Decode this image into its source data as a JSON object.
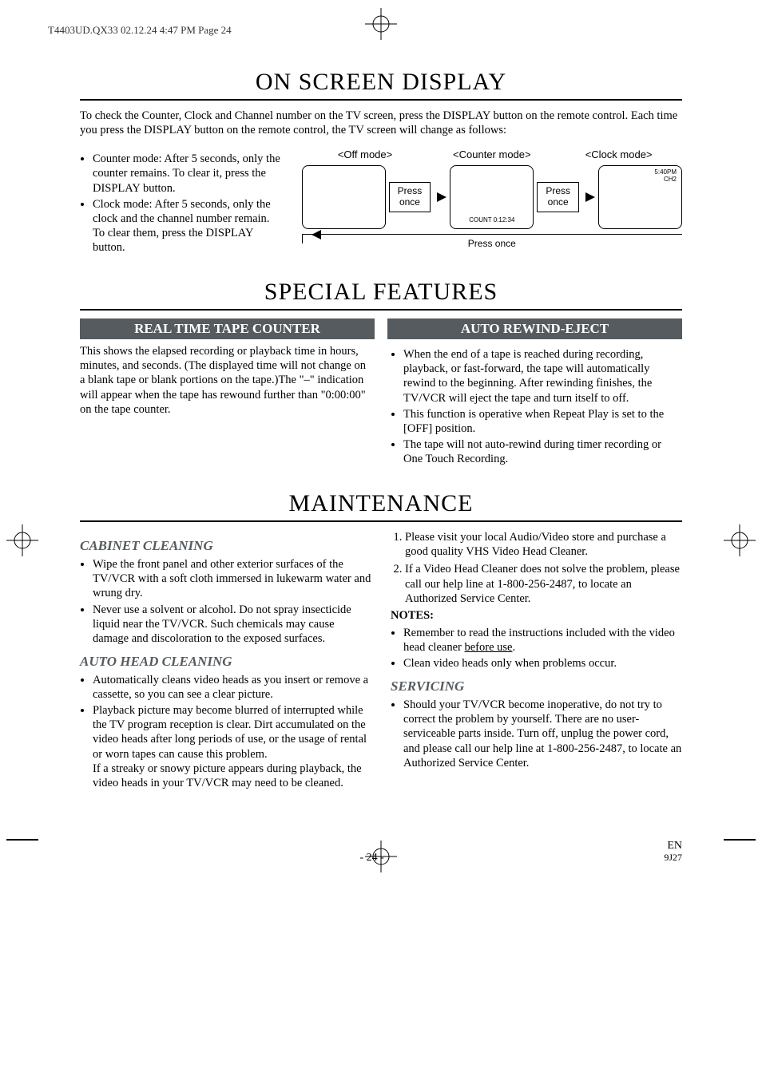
{
  "printHeader": "T4403UD.QX33  02.12.24  4:47 PM  Page 24",
  "sections": {
    "osd": {
      "title": "ON SCREEN DISPLAY",
      "intro": "To check the Counter, Clock and Channel number on the TV screen, press the DISPLAY button on the remote control. Each time you press the DISPLAY button on the remote control, the TV screen will change as follows:",
      "bullets": [
        "Counter mode: After 5 seconds, only the counter remains. To clear it, press the DISPLAY button.",
        "Clock mode: After 5 seconds, only the clock and the channel number remain. To clear them, press the DISPLAY button."
      ],
      "diagram": {
        "offLabel": "<Off mode>",
        "counterLabel": "<Counter mode>",
        "clockLabel": "<Clock mode>",
        "pressOnce": "Press once",
        "press": "Press",
        "once": "once",
        "countReadout": "COUNT  0:12:34",
        "clockReadout1": "5:40PM",
        "clockReadout2": "CH2"
      }
    },
    "special": {
      "title": "SPECIAL FEATURES",
      "rtc": {
        "heading": "REAL TIME TAPE COUNTER",
        "body": "This shows the elapsed recording or playback time in hours, minutes, and seconds. (The displayed time will not change on a blank tape or blank portions on the tape.)The \"–\" indication will appear when the tape has rewound further than \"0:00:00\" on the tape counter."
      },
      "are": {
        "heading": "AUTO REWIND-EJECT",
        "bullets": [
          "When the end of a tape is reached during recording, playback, or fast-forward, the tape will automatically rewind to the beginning. After rewinding finishes, the TV/VCR will eject the tape and turn itself to off.",
          "This function is operative when Repeat Play is set to the [OFF] position.",
          "The tape will not auto-rewind during timer recording or One Touch Recording."
        ]
      }
    },
    "maint": {
      "title": "MAINTENANCE",
      "cabinet": {
        "heading": "CABINET CLEANING",
        "bullets": [
          "Wipe the front panel and other exterior surfaces of the TV/VCR with a soft cloth immersed in lukewarm water and wrung dry.",
          "Never use a solvent or alcohol. Do not spray insecticide liquid near the TV/VCR. Such chemicals may cause damage and discoloration to the exposed surfaces."
        ]
      },
      "autohead": {
        "heading": "AUTO HEAD CLEANING",
        "bullets": [
          "Automatically cleans video heads as you insert or remove a cassette, so you can see a clear picture.",
          "Playback picture may become blurred of interrupted while the TV program reception is clear. Dirt accumulated on the video heads after long periods of use, or the usage of rental or worn tapes can cause this problem."
        ],
        "tail": "If a streaky or snowy picture appears during playback, the video heads in your TV/VCR may need to be cleaned."
      },
      "rightSteps": [
        "Please visit your local Audio/Video store and purchase a good quality VHS Video Head Cleaner.",
        "If a Video Head Cleaner does not solve the problem, please call our help line at 1-800-256-2487, to locate an Authorized Service Center."
      ],
      "notesLabel": "NOTES:",
      "notesBullets": [
        "Remember to read the instructions included with the video head cleaner ",
        "Clean video heads only when problems occur."
      ],
      "beforeUse": "before use",
      "servicing": {
        "heading": "SERVICING",
        "bullets": [
          "Should your TV/VCR become inoperative, do not try to correct the problem by yourself. There are no user-serviceable parts inside. Turn off, unplug the power cord, and please call our help line at 1-800-256-2487, to locate an Authorized Service Center."
        ]
      }
    }
  },
  "footer": {
    "page": "- 24 -",
    "lang": "EN",
    "code": "9J27"
  }
}
